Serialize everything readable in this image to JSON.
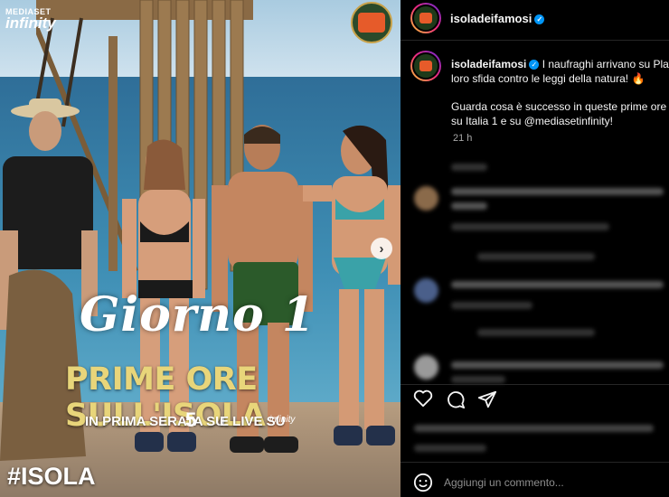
{
  "media": {
    "brand_top": "MEDIASET",
    "brand_bottom": "infinity",
    "title_script": "Giorno 1",
    "headline": "PRIME ORE SULL'ISOLA",
    "subline_1": "IN PRIMA SERATA SU",
    "subline_2": "E LIVE SU",
    "channel": "5",
    "brand_small": "infinity",
    "hashtag": "#ISOLA"
  },
  "header": {
    "username": "isoladeifamosi",
    "verified_mark": "✓"
  },
  "post": {
    "username": "isoladeifamosi",
    "caption_line1": "I naufraghi arrivano su Play",
    "caption_line2": "loro sfida contro le leggi della natura! 🔥",
    "caption_line3": "Guarda cosa è successo in queste prime ore n",
    "caption_line4": "su Italia 1 e su @mediasetinfinity!",
    "time": "21 h"
  },
  "comment_box": {
    "placeholder": "Aggiungi un commento..."
  },
  "colors": {
    "background": "#000000",
    "accent": "#0095f6",
    "headline": "#e8d57a"
  }
}
